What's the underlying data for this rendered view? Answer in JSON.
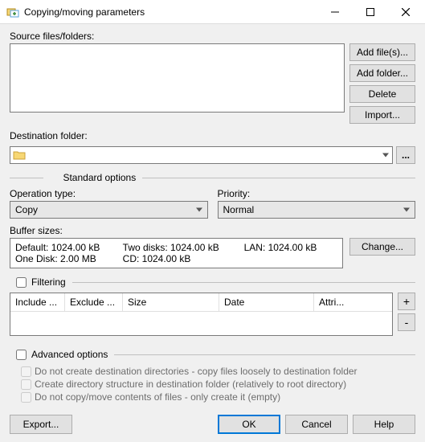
{
  "window": {
    "title": "Copying/moving parameters"
  },
  "source": {
    "label": "Source files/folders:",
    "buttons": {
      "add_files": "Add file(s)...",
      "add_folder": "Add folder...",
      "delete": "Delete",
      "import": "Import..."
    }
  },
  "destination": {
    "label": "Destination folder:",
    "value": "",
    "browse": "..."
  },
  "standard": {
    "title": "Standard options",
    "operation": {
      "label": "Operation type:",
      "value": "Copy"
    },
    "priority": {
      "label": "Priority:",
      "value": "Normal"
    },
    "buffer": {
      "label": "Buffer sizes:",
      "default": "Default: 1024.00 kB",
      "two_disks": "Two disks: 1024.00 kB",
      "lan": "LAN: 1024.00 kB",
      "one_disk": "One Disk: 2.00 MB",
      "cd": "CD: 1024.00 kB",
      "change": "Change..."
    }
  },
  "filtering": {
    "title": "Filtering",
    "columns": {
      "include": "Include ...",
      "exclude": "Exclude ...",
      "size": "Size",
      "date": "Date",
      "attri": "Attri..."
    },
    "add": "+",
    "remove": "-"
  },
  "advanced": {
    "title": "Advanced options",
    "opt1": "Do not create destination directories - copy files loosely to destination folder",
    "opt2": "Create directory structure in destination folder (relatively to root directory)",
    "opt3": "Do not copy/move contents of files - only create it (empty)"
  },
  "footer": {
    "export": "Export...",
    "ok": "OK",
    "cancel": "Cancel",
    "help": "Help"
  }
}
